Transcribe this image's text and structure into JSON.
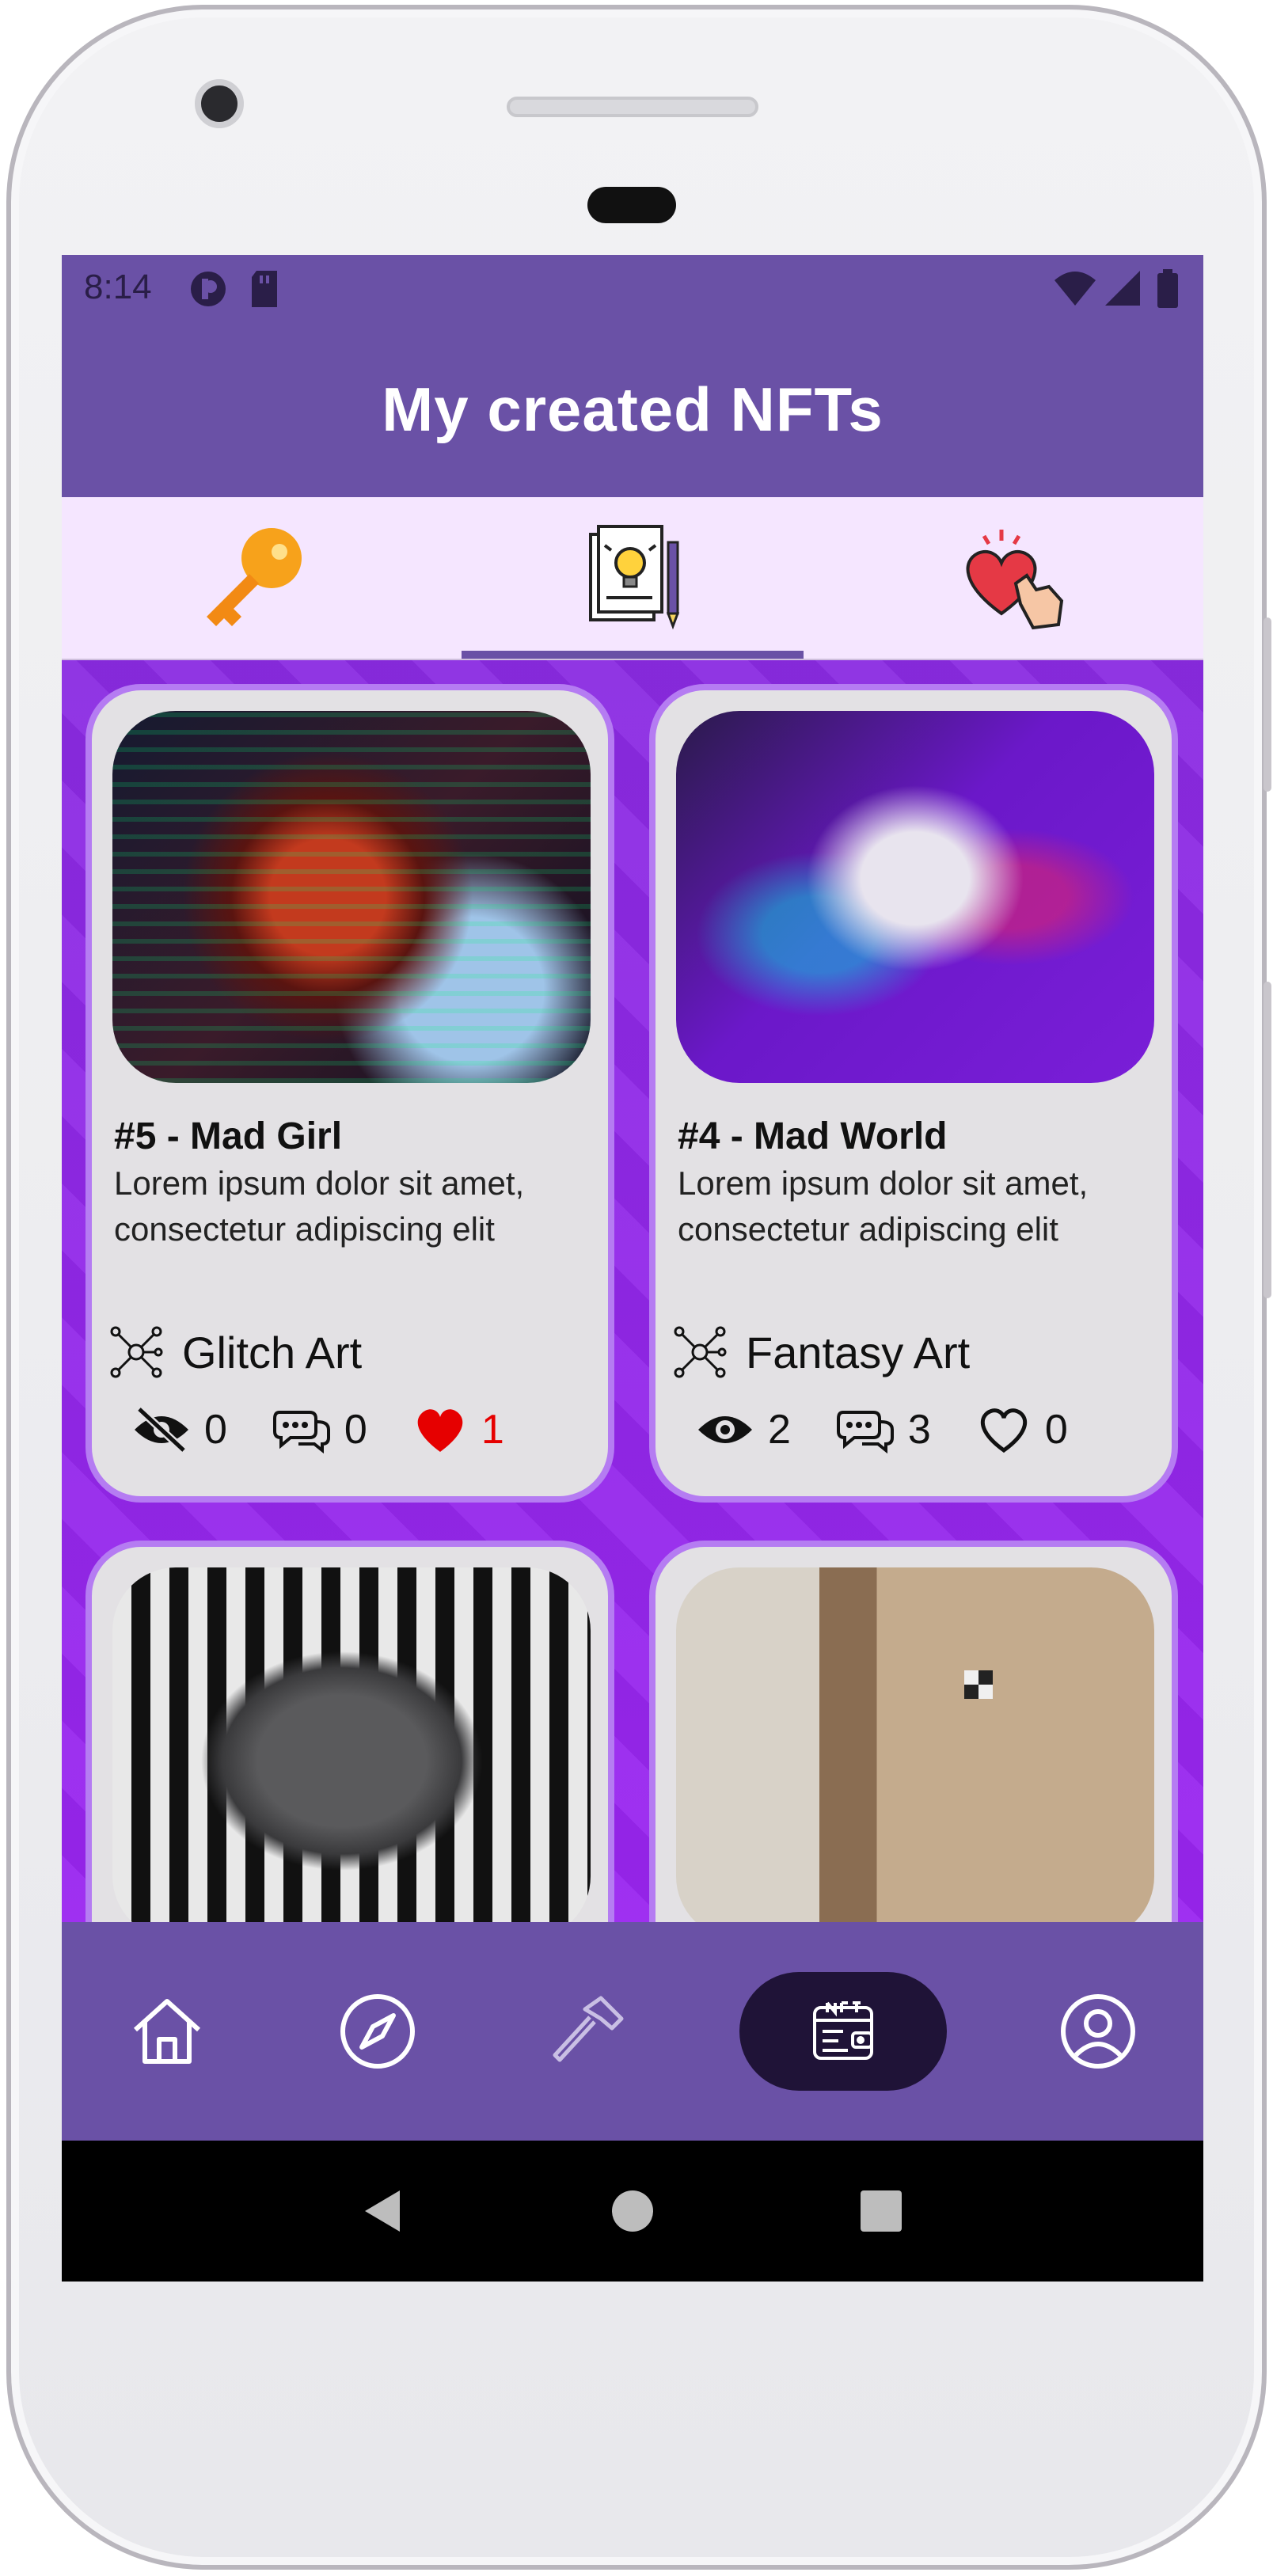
{
  "statusbar": {
    "time": "8:14"
  },
  "header": {
    "title": "My created NFTs"
  },
  "tabs": [
    {
      "name": "key-icon",
      "active": false
    },
    {
      "name": "idea-paper-icon",
      "active": true
    },
    {
      "name": "heart-hand-icon",
      "active": false
    }
  ],
  "cards": [
    {
      "title": "#5 - Mad Girl",
      "description": "Lorem ipsum dolor sit amet, consectetur adipiscing elit",
      "category": "Glitch Art",
      "views": "0",
      "comments": "0",
      "likes": "1"
    },
    {
      "title": "#4 - Mad World",
      "description": "Lorem ipsum dolor sit amet, consectetur adipiscing elit",
      "category": "Fantasy Art",
      "views": "2",
      "comments": "3",
      "likes": "0"
    }
  ],
  "bottom_nav": [
    "home-icon",
    "compass-icon",
    "hammer-icon",
    "nft-wallet-icon",
    "profile-icon"
  ],
  "colors": {
    "primary": "#6a51a6",
    "tab_bg": "#f5e6ff",
    "content_bg": "#8a2be2",
    "like_red": "#e60000"
  }
}
